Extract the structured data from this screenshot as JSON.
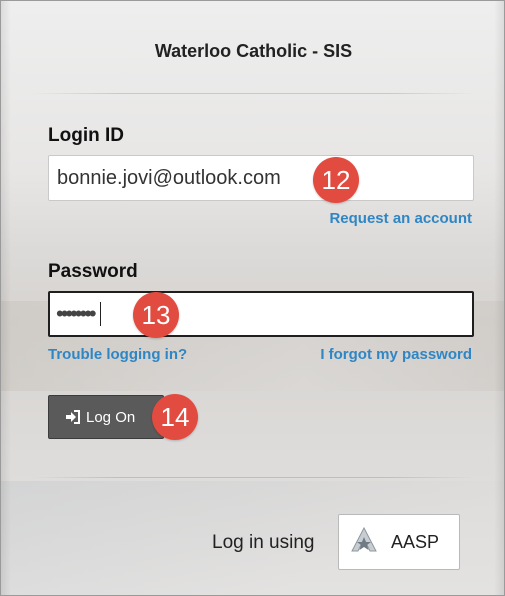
{
  "header": {
    "title": "Waterloo Catholic - SIS"
  },
  "login": {
    "label": "Login ID",
    "value": "bonnie.jovi@outlook.com",
    "request_link": "Request an account"
  },
  "password": {
    "label": "Password",
    "masked_value": "••••••••",
    "trouble_link": "Trouble logging in?",
    "forgot_link": "I forgot my password"
  },
  "actions": {
    "logon_label": "Log On",
    "logon_icon": "sign-in-icon"
  },
  "badges": {
    "login_badge": "12",
    "password_badge": "13",
    "logon_badge": "14"
  },
  "alt_login": {
    "label": "Log in using",
    "provider": "AASP",
    "provider_icon": "aasp-logo-icon"
  },
  "colors": {
    "link": "#2f86c5",
    "badge": "#e24b3f",
    "button": "#5a5a5a"
  }
}
